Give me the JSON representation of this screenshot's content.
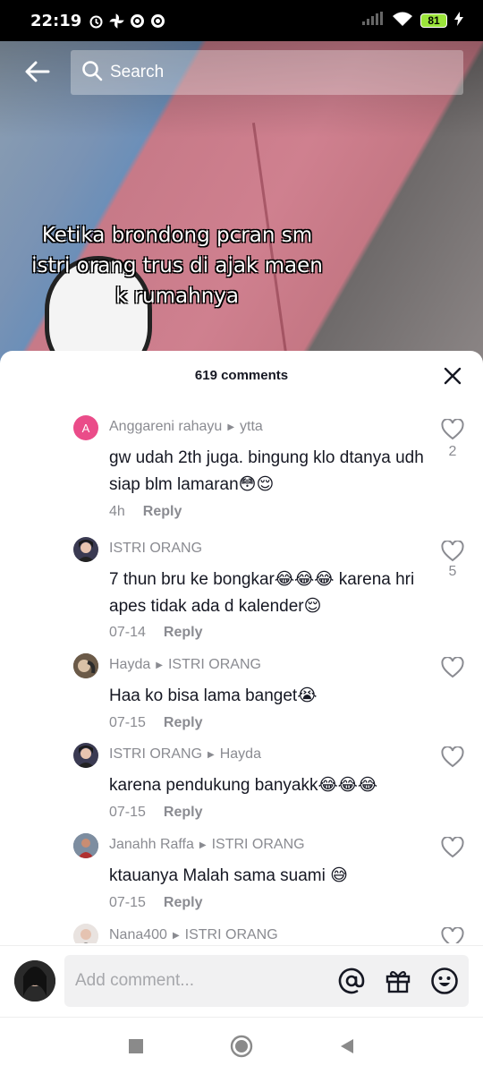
{
  "status": {
    "time": "22:19",
    "battery": "81"
  },
  "search": {
    "placeholder": "Search"
  },
  "video": {
    "caption_lines": [
      "Ketika brondong pcran sm",
      "istri orang trus di ajak maen",
      "k rumahnya"
    ]
  },
  "comments_panel": {
    "title": "619 comments",
    "items": [
      {
        "user": "Anggareni rahayu",
        "reply_to": "ytta",
        "avatar_letter": "A",
        "text": "gw udah 2th juga. bingung klo dtanya udh siap blm lamaran😳😌",
        "time": "4h",
        "reply_label": "Reply",
        "likes": "2"
      },
      {
        "user": "ISTRI ORANG",
        "reply_to": "",
        "text": "7 thun bru ke bongkar😂😂😂 karena hri apes tidak ada d kalender😌",
        "time": "07-14",
        "reply_label": "Reply",
        "likes": "5"
      },
      {
        "user": "Hayda",
        "reply_to": "ISTRI ORANG",
        "text": "Haa ko bisa lama banget😭",
        "time": "07-15",
        "reply_label": "Reply",
        "likes": ""
      },
      {
        "user": "ISTRI ORANG",
        "reply_to": "Hayda",
        "text": "karena pendukung banyakk😂😂😂",
        "time": "07-15",
        "reply_label": "Reply",
        "likes": ""
      },
      {
        "user": "Janahh Raffa",
        "reply_to": "ISTRI ORANG",
        "text": "ktauanya Malah sama suami 😅",
        "time": "07-15",
        "reply_label": "Reply",
        "likes": ""
      },
      {
        "user": "Nana400",
        "reply_to": "ISTRI ORANG",
        "text": "",
        "time": "",
        "reply_label": "",
        "likes": ""
      }
    ]
  },
  "input": {
    "placeholder": "Add comment..."
  },
  "icons": [
    "back-arrow-icon",
    "search-icon",
    "close-icon",
    "heart-icon",
    "at-icon",
    "gift-icon",
    "emoji-icon",
    "nav-square-icon",
    "nav-circle-icon",
    "nav-triangle-icon"
  ]
}
